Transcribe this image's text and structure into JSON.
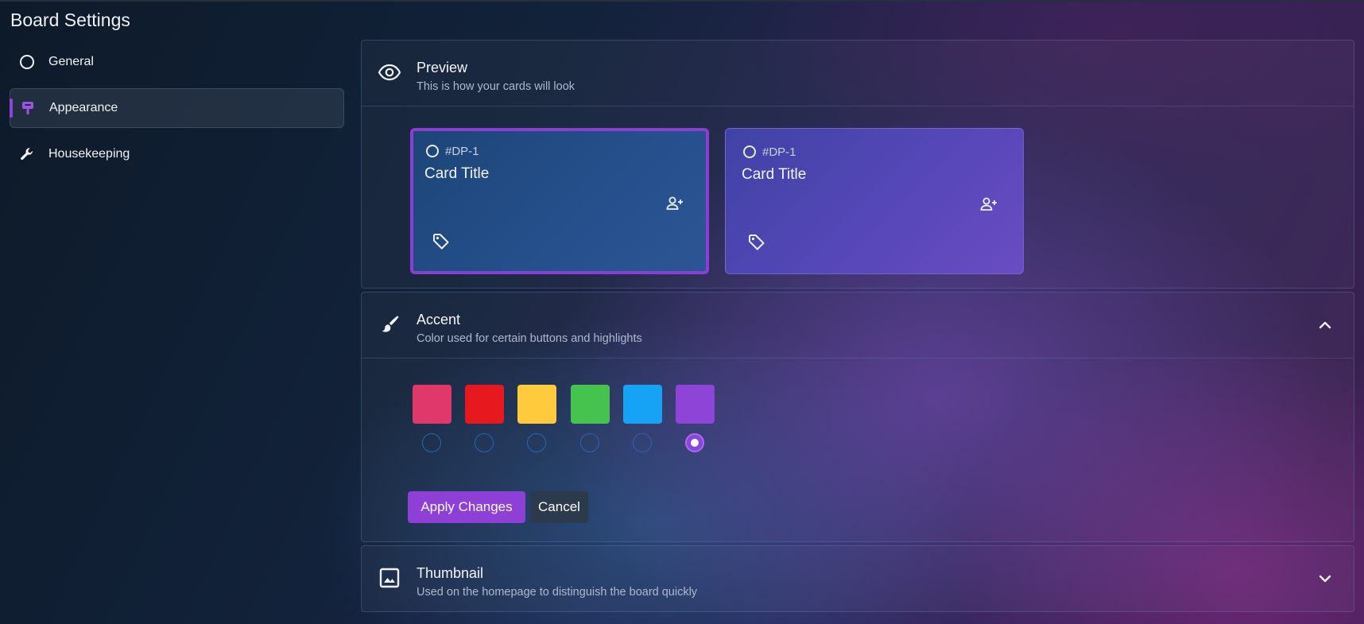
{
  "page": {
    "title": "Board Settings"
  },
  "sidebar": {
    "items": [
      {
        "label": "General",
        "icon": "circle-icon",
        "active": false
      },
      {
        "label": "Appearance",
        "icon": "paint-roller-icon",
        "active": true
      },
      {
        "label": "Housekeeping",
        "icon": "wrench-icon",
        "active": false
      }
    ]
  },
  "preview": {
    "title": "Preview",
    "subtitle": "This is how your cards will look",
    "icon": "eye-icon",
    "cards": [
      {
        "id": "#DP-1",
        "title": "Card Title",
        "style": "blue",
        "selected": true
      },
      {
        "id": "#DP-1",
        "title": "Card Title",
        "style": "purple",
        "selected": false
      }
    ]
  },
  "accent": {
    "title": "Accent",
    "subtitle": "Color used for certain buttons and highlights",
    "icon": "brush-icon",
    "expanded": true,
    "colors": [
      "#e0386b",
      "#e8191e",
      "#ffcb3d",
      "#46c24e",
      "#16a3f5",
      "#8e44d6"
    ],
    "selected_index": 5,
    "apply_label": "Apply Changes",
    "cancel_label": "Cancel"
  },
  "thumbnail": {
    "title": "Thumbnail",
    "subtitle": "Used on the homepage to distinguish the board quickly",
    "icon": "image-icon",
    "expanded": false
  },
  "colors": {
    "accent": "#8e44d6",
    "apply_button": "#8e3fd6",
    "cancel_button": "#2b3a4c"
  }
}
